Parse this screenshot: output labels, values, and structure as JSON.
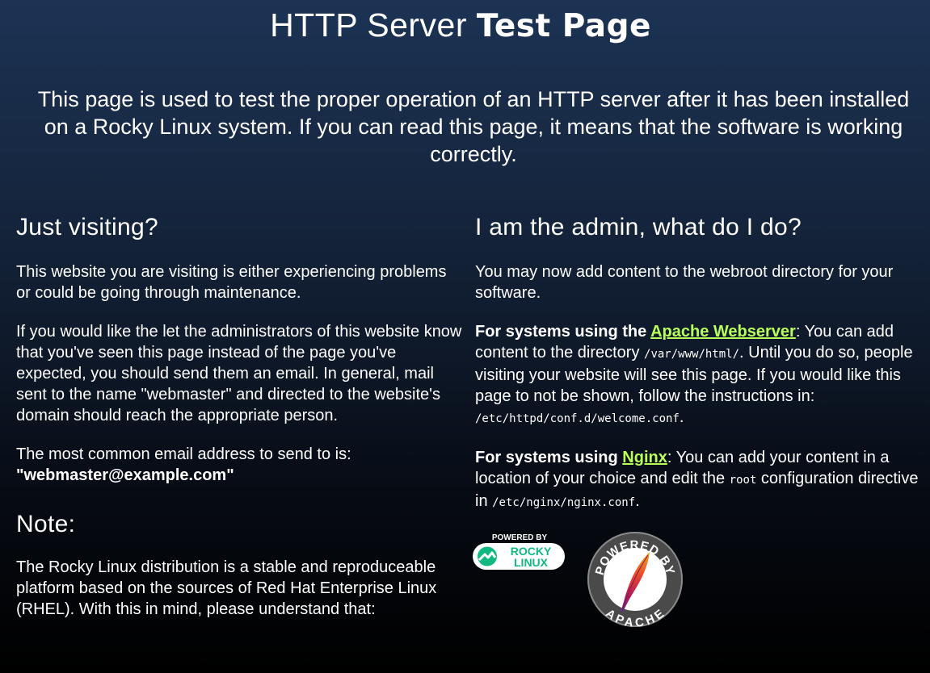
{
  "header": {
    "title_regular": "HTTP Server ",
    "title_bold": "Test Page"
  },
  "intro": {
    "text": "This page is used to test the proper operation of an HTTP server after it has been installed on a Rocky Linux system. If you can read this page, it means that the software is working correctly."
  },
  "left": {
    "heading": "Just visiting?",
    "p1": "This website you are visiting is either experiencing problems or could be going through maintenance.",
    "p2": "If you would like the let the administrators of this website know that you've seen this page instead of the page you've expected, you should send them an email. In general, mail sent to the name \"webmaster\" and directed to the website's domain should reach the appropriate person.",
    "p3_text": "The most common email address to send to is:",
    "p3_email": "\"webmaster@example.com\"",
    "note_heading": "Note:",
    "note_text": "The Rocky Linux distribution is a stable and reproduceable platform based on the sources of Red Hat Enterprise Linux (RHEL). With this in mind, please understand that:"
  },
  "right": {
    "heading": "I am the admin, what do I do?",
    "p1": "You may now add content to the webroot directory for your software.",
    "apache": {
      "lead": "For systems using the ",
      "link": "Apache Webserver",
      "text1": ": You can add content to the directory ",
      "code1": "/var/www/html/",
      "text2": ". Until you do so, people visiting your website will see this page. If you would like this page to not be shown, follow the instructions in: ",
      "code2": "/etc/httpd/conf.d/welcome.conf",
      "text3": "."
    },
    "nginx": {
      "lead": "For systems using ",
      "link": "Nginx",
      "text1": ": You can add your content in a location of your choice and edit the ",
      "code1": "root",
      "text2": " configuration directive in ",
      "code2": "/etc/nginx/nginx.conf",
      "text3": "."
    }
  },
  "logos": {
    "rocky_powered": "POWERED BY",
    "rocky_line1": "ROCKY",
    "rocky_line2": "LINUX",
    "apache_top": "POWERED BY",
    "apache_bottom": "APACHE"
  },
  "colors": {
    "link": "#b8ff5a",
    "rocky_green": "#10b981"
  }
}
